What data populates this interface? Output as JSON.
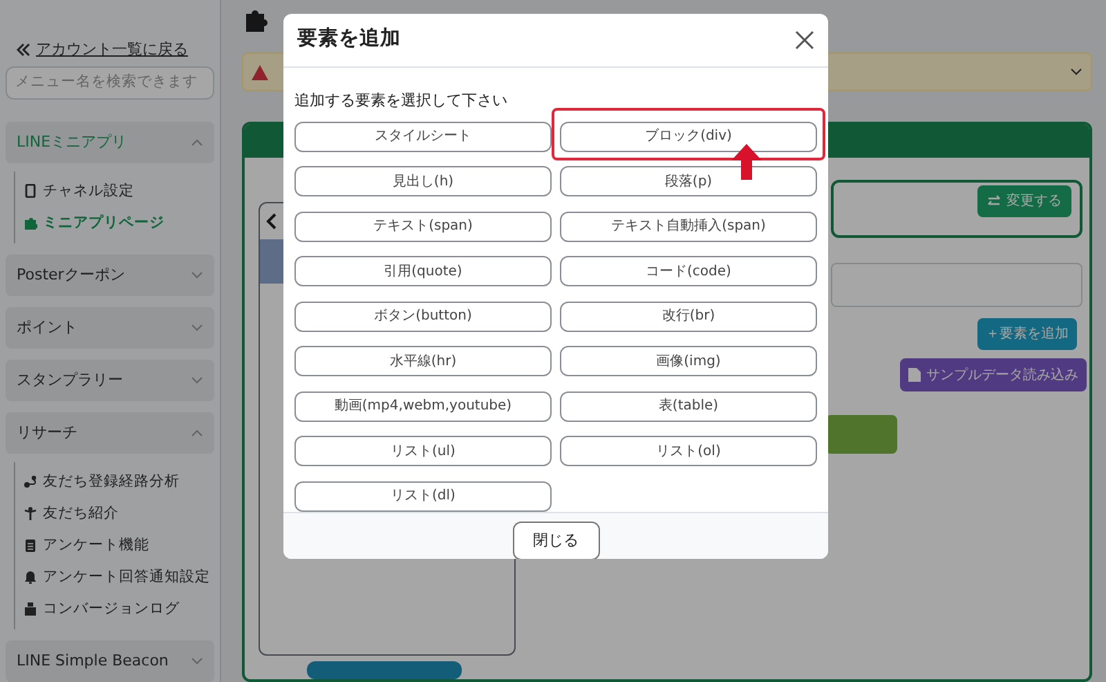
{
  "sidebar": {
    "back_link": "アカウント一覧に戻る",
    "search": {
      "placeholder": "メニュー名を検索できます"
    },
    "sections": [
      {
        "label": "LINEミニアプリ",
        "selected": true,
        "expanded": true,
        "items": [
          {
            "label": "チャネル設定",
            "selected": false
          },
          {
            "label": "ミニアプリページ",
            "selected": true
          }
        ]
      },
      {
        "label": "Posterクーポン",
        "selected": false,
        "expanded": false
      },
      {
        "label": "ポイント",
        "selected": false,
        "expanded": false
      },
      {
        "label": "スタンプラリー",
        "selected": false,
        "expanded": false
      },
      {
        "label": "リサーチ",
        "selected": false,
        "expanded": true,
        "items": [
          {
            "label": "友だち登録経路分析",
            "selected": false
          },
          {
            "label": "友だち紹介",
            "selected": false
          },
          {
            "label": "アンケート機能",
            "selected": false
          },
          {
            "label": "アンケート回答通知設定",
            "selected": false
          },
          {
            "label": "コンバージョンログ",
            "selected": false
          }
        ]
      },
      {
        "label": "LINE Simple Beacon",
        "selected": false,
        "expanded": false
      }
    ]
  },
  "main": {
    "change_button": "変更する",
    "add_button": "＋要素を追加",
    "sample_button": "サンプルデータ読み込み"
  },
  "modal": {
    "title": "要素を追加",
    "prompt": "追加する要素を選択して下さい",
    "options": [
      {
        "label": "スタイルシート",
        "highlighted": false
      },
      {
        "label": "ブロック(div)",
        "highlighted": true
      },
      {
        "label": "見出し(h)",
        "highlighted": false
      },
      {
        "label": "段落(p)",
        "highlighted": false
      },
      {
        "label": "テキスト(span)",
        "highlighted": false
      },
      {
        "label": "テキスト自動挿入(span)",
        "highlighted": false
      },
      {
        "label": "引用(quote)",
        "highlighted": false
      },
      {
        "label": "コード(code)",
        "highlighted": false
      },
      {
        "label": "ボタン(button)",
        "highlighted": false
      },
      {
        "label": "改行(br)",
        "highlighted": false
      },
      {
        "label": "水平線(hr)",
        "highlighted": false
      },
      {
        "label": "画像(img)",
        "highlighted": false
      },
      {
        "label": "動画(mp4,webm,youtube)",
        "highlighted": false
      },
      {
        "label": "表(table)",
        "highlighted": false
      },
      {
        "label": "リスト(ul)",
        "highlighted": false
      },
      {
        "label": "リスト(ol)",
        "highlighted": false
      },
      {
        "label": "リスト(dl)",
        "highlighted": false
      }
    ],
    "close_button": "閉じる"
  }
}
